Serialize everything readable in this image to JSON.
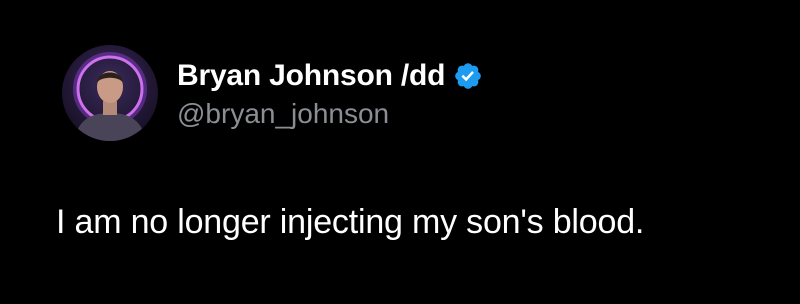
{
  "author": {
    "display_name": "Bryan Johnson /dd",
    "handle": "@bryan_johnson",
    "verified": true,
    "avatar_icon": "profile-photo-icon"
  },
  "tweet": {
    "text": "I am no longer injecting my son's blood."
  },
  "colors": {
    "background": "#000000",
    "text": "#ffffff",
    "secondary_text": "#8b8f94",
    "verified_badge": "#1d9bf0",
    "avatar_ring": "#c04cff"
  }
}
